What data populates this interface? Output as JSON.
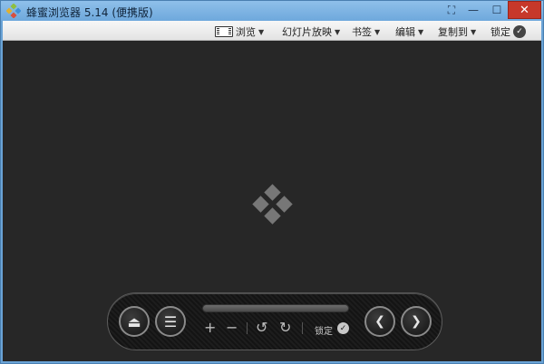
{
  "window": {
    "title": "蜂蜜浏览器 5.14 (便携版)",
    "close_glyph": "✕",
    "min_glyph": "—",
    "max_glyph": "☐",
    "fit_glyph": "⛶"
  },
  "menu": {
    "items": [
      {
        "label": "浏览",
        "icon": "film-icon"
      },
      {
        "label": "幻灯片放映"
      },
      {
        "label": "书签"
      },
      {
        "label": "编辑"
      },
      {
        "label": "复制到"
      },
      {
        "label": "锁定",
        "icon": "check-circle-icon"
      }
    ],
    "caret": "▼",
    "check_glyph": "✓"
  },
  "panel": {
    "eject_glyph": "⏏",
    "menu_glyph": "☰",
    "zoom_in": "+",
    "zoom_out": "−",
    "rotate_left": "↺",
    "rotate_right": "↻",
    "lock_label": "锁定",
    "check_glyph": "✓",
    "prev_glyph": "❮",
    "next_glyph": "❯"
  },
  "colors": {
    "title_bar": "#7ab2e2",
    "close_button": "#c7382a",
    "viewer_bg": "#272727"
  }
}
